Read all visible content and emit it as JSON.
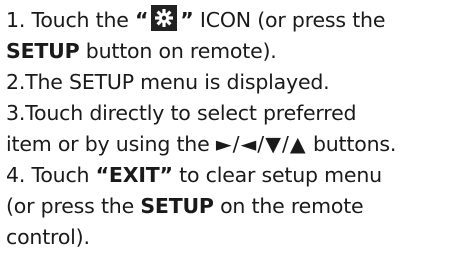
{
  "instructions": {
    "step1": {
      "prefix": "1. Touch the ",
      "quote_open": "“",
      "icon": "gear-icon",
      "quote_close": "”",
      "suffix": " ICON (or press the",
      "cont_bold": "SETUP",
      "cont_rest": " button on remote)."
    },
    "step2": {
      "text": "2.The SETUP menu is displayed."
    },
    "step3": {
      "line1": "3.Touch directly to select preferred",
      "line2_start": "item or by using the ",
      "arrows": "►/◄/▼/▲",
      "line2_end": " buttons."
    },
    "step4": {
      "prefix": "4. Touch ",
      "bold": "“EXIT”",
      "suffix": " to clear setup menu",
      "line2_start": "(or press the ",
      "line2_bold": "SETUP",
      "line2_end": " on the remote",
      "line3": "control)."
    }
  }
}
